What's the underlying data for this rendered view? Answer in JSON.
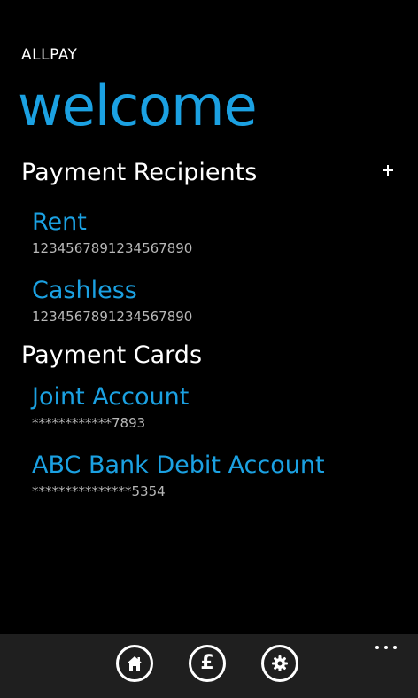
{
  "app": {
    "name": "ALLPAY",
    "page_title": "welcome"
  },
  "recipients": {
    "header": "Payment Recipients",
    "add_icon": "plus-icon",
    "items": [
      {
        "title": "Rent",
        "subtitle": "1234567891234567890"
      },
      {
        "title": "Cashless",
        "subtitle": "1234567891234567890"
      }
    ]
  },
  "cards": {
    "header": "Payment Cards",
    "items": [
      {
        "title": "Joint Account",
        "subtitle": "************7893"
      },
      {
        "title": "ABC Bank Debit Account",
        "subtitle": "***************5354"
      }
    ]
  },
  "app_bar": {
    "buttons": [
      {
        "icon": "home-icon"
      },
      {
        "icon": "pound-icon",
        "glyph": "£"
      },
      {
        "icon": "settings-gear-icon"
      }
    ],
    "more_icon": "ellipsis-icon"
  },
  "colors": {
    "accent": "#1ba1e2",
    "background": "#000000",
    "app_bar": "#1f1f1f",
    "secondary_text": "#b8b8b8"
  }
}
